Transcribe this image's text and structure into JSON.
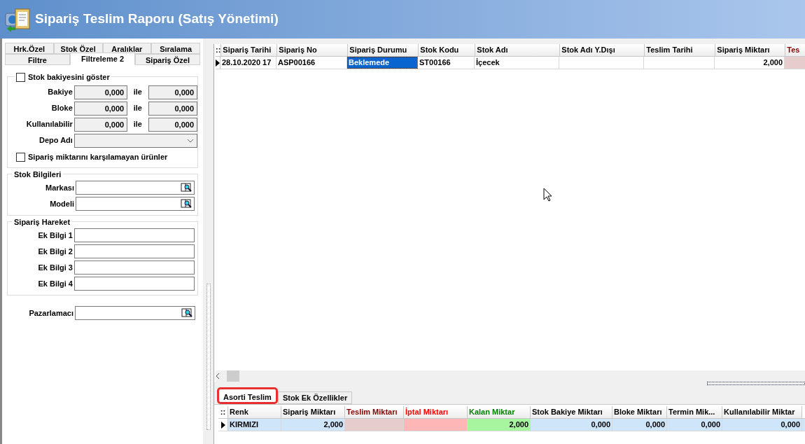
{
  "window": {
    "title": "Sipariş Teslim Raporu (Satış Yönetimi)"
  },
  "filter_tabs": [
    [
      {
        "label": "Hrk.Özel",
        "selected": false
      },
      {
        "label": "Stok Özel",
        "selected": false
      },
      {
        "label": "Aralıklar",
        "selected": false
      },
      {
        "label": "Sıralama",
        "selected": false
      }
    ],
    [
      {
        "label": "Filtre",
        "selected": false
      },
      {
        "label": "Filtreleme 2",
        "selected": true
      },
      {
        "label": "Sipariş Özel",
        "selected": false
      }
    ]
  ],
  "stock_balance": {
    "checkbox": {
      "label": "Stok bakiyesini göster",
      "checked": false
    },
    "ranges": [
      {
        "label": "Bakiye",
        "from": "0,000",
        "joiner": "ile",
        "to": "0,000"
      },
      {
        "label": "Bloke",
        "from": "0,000",
        "joiner": "ile",
        "to": "0,000"
      },
      {
        "label": "Kullanılabilir",
        "from": "0,000",
        "joiner": "ile",
        "to": "0,000"
      }
    ],
    "warehouse": {
      "label": "Depo Adı"
    },
    "unmet_checkbox": {
      "label": "Sipariş miktarını karşılamayan ürünler",
      "checked": false
    }
  },
  "stock_info": {
    "title": "Stok Bilgileri",
    "fields": [
      {
        "label": "Markası"
      },
      {
        "label": "Modeli"
      }
    ]
  },
  "order_movement": {
    "title": "Sipariş Hareket",
    "fields": [
      {
        "label": "Ek Bilgi 1"
      },
      {
        "label": "Ek Bilgi 2"
      },
      {
        "label": "Ek Bilgi 3"
      },
      {
        "label": "Ek Bilgi 4"
      }
    ]
  },
  "marketer": {
    "label": "Pazarlamacı"
  },
  "order_grid": {
    "corner_mark": "::",
    "columns": [
      {
        "label": "Sipariş Tarihi",
        "kind": "text"
      },
      {
        "label": "Sipariş No",
        "kind": "text"
      },
      {
        "label": "Sipariş Durumu",
        "kind": "text"
      },
      {
        "label": "Stok Kodu",
        "kind": "text"
      },
      {
        "label": "Stok Adı",
        "kind": "text"
      },
      {
        "label": "Stok Adı Y.Dışı",
        "kind": "text"
      },
      {
        "label": "Teslim Tarihi",
        "kind": "text"
      },
      {
        "label": "Sipariş Miktarı",
        "kind": "number"
      },
      {
        "label": "Tes",
        "kind": "delivered"
      }
    ],
    "rows": [
      {
        "selected": true,
        "cells": [
          {
            "text": "28.10.2020 17",
            "focused": false
          },
          {
            "text": "ASP00166",
            "focused": false
          },
          {
            "text": "Beklemede",
            "focused": true
          },
          {
            "text": "ST00166",
            "focused": false
          },
          {
            "text": "İçecek",
            "focused": false
          },
          {
            "focused": false
          },
          {
            "focused": false
          },
          {
            "text": "2,000",
            "focused": false
          },
          {
            "focused": false
          }
        ]
      }
    ]
  },
  "detail_tabs": [
    {
      "label": "Asorti Teslim",
      "selected": true,
      "highlighted": true
    },
    {
      "label": "Stok Ek Özellikler",
      "selected": false,
      "highlighted": false
    }
  ],
  "detail_grid": {
    "corner_mark": "::",
    "columns": [
      {
        "label": "Renk",
        "kind": "text"
      },
      {
        "label": "Sipariş Miktarı",
        "kind": "number"
      },
      {
        "label": "Teslim Miktarı",
        "kind": "delivered"
      },
      {
        "label": "İptal Miktarı",
        "kind": "cancelled"
      },
      {
        "label": "Kalan Miktar",
        "kind": "remaining"
      },
      {
        "label": "Stok Bakiye Miktarı",
        "kind": "number"
      },
      {
        "label": "Bloke Miktarı",
        "kind": "number"
      },
      {
        "label": "Termin Mik...",
        "kind": "number"
      },
      {
        "label": "Kullanılabilir Miktar",
        "kind": "number"
      }
    ],
    "rows": [
      {
        "selected": true,
        "cells": [
          {
            "text": "KIRMIZI"
          },
          {
            "text": "2,000"
          },
          {},
          {},
          {
            "text": "2,000"
          },
          {
            "text": "0,000"
          },
          {
            "text": "0,000"
          },
          {
            "text": "0,000"
          },
          {
            "text": "0,000"
          }
        ]
      }
    ]
  }
}
